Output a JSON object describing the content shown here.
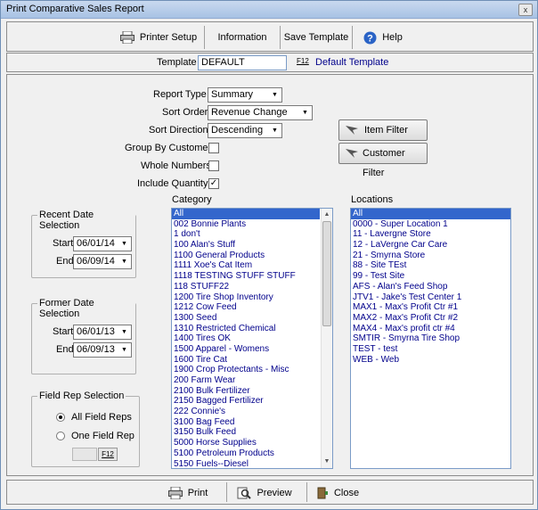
{
  "title": "Print Comparative Sales Report",
  "close_glyph": "x",
  "toolbar": {
    "printer_setup": "Printer Setup",
    "information": "Information",
    "save_template": "Save Template",
    "help": "Help"
  },
  "template": {
    "label": "Template",
    "value": "DEFAULT",
    "f12": "F12",
    "description": "Default Template"
  },
  "report_type": {
    "label": "Report Type",
    "value": "Summary"
  },
  "sort_order": {
    "label": "Sort Order",
    "value": "Revenue Change"
  },
  "sort_direction": {
    "label": "Sort Direction",
    "value": "Descending"
  },
  "group_by_customer": {
    "label": "Group By Customer",
    "checked": false
  },
  "whole_numbers": {
    "label": "Whole Numbers",
    "checked": false
  },
  "include_quantity": {
    "label": "Include Quantity",
    "checked": true,
    "mark": "✓"
  },
  "item_filter": "Item Filter",
  "customer_filter": "Customer Filter",
  "recent": {
    "title": "Recent Date Selection",
    "start_label": "Start",
    "start": "06/01/14",
    "end_label": "End",
    "end": "06/09/14"
  },
  "former": {
    "title": "Former Date Selection",
    "start_label": "Start",
    "start": "06/01/13",
    "end_label": "End",
    "end": "06/09/13"
  },
  "field_rep": {
    "title": "Field Rep Selection",
    "all": "All Field Reps",
    "one": "One Field Rep",
    "f12": "F12",
    "selected": "all"
  },
  "category": {
    "label": "Category",
    "items": [
      "All",
      "002 Bonnie Plants",
      "1 don't",
      "100 Alan's Stuff",
      "1100 General Products",
      "1111 Xoe's Cat Item",
      "1118 TESTING STUFF STUFF",
      "118 STUFF22",
      "1200 Tire Shop Inventory",
      "1212 Cow Feed",
      "1300 Seed",
      "1310 Restricted Chemical",
      "1400 Tires OK",
      "1500 Apparel - Womens",
      "1600 Tire Cat",
      "1900 Crop Protectants - Misc",
      "200 Farm Wear",
      "2100 Bulk Fertilizer",
      "2150 Bagged Fertilizer",
      "222 Connie's",
      "3100 Bag Feed",
      "3150 Bulk Feed",
      "5000 Horse Supplies",
      "5100 Petroleum Products",
      "5150 Fuels--Diesel"
    ]
  },
  "locations": {
    "label": "Locations",
    "items": [
      "All",
      "0000 - Super Location 1",
      "11 - Lavergne Store",
      "12 - LaVergne Car Care",
      "21 - Smyrna Store",
      "88 - Site TEst",
      "99 - Test Site",
      "AFS - Alan's Feed Shop",
      "JTV1 - Jake's Test Center 1",
      "MAX1 - Max's Profit Ctr #1",
      "MAX2 - Max's Profit Ctr #2",
      "MAX4 - Max's profit ctr #4",
      "SMTIR - Smyrna Tire Shop",
      "TEST - test",
      "WEB - Web"
    ]
  },
  "bottom": {
    "print": "Print",
    "preview": "Preview",
    "close": "Close"
  },
  "icons": {
    "printer": "printer-icon",
    "info": "info-icon",
    "help": "help-icon",
    "filter": "filter-icon",
    "print": "print-icon",
    "preview": "preview-icon",
    "close": "exit-door-icon"
  },
  "colors": {
    "list_text": "#00008b",
    "selection": "#3366cc",
    "template_desc": "#00008b"
  }
}
